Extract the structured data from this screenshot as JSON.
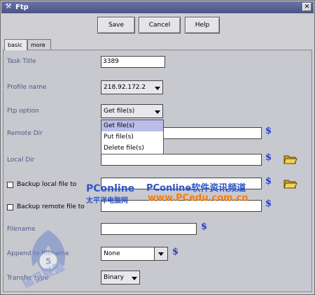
{
  "window": {
    "title": "Ftp",
    "close_glyph": "✕"
  },
  "toolbar": {
    "save": "Save",
    "cancel": "Cancel",
    "help": "Help"
  },
  "tabs": [
    {
      "label": "basic",
      "active": true
    },
    {
      "label": "more",
      "active": false
    }
  ],
  "form": {
    "task_title": {
      "label": "Task Title",
      "value": "3389"
    },
    "profile_name": {
      "label": "Profile name",
      "value": "218.92.172.2"
    },
    "ftp_option": {
      "label": "Ftp option",
      "value": "Get file(s)"
    },
    "remote_dir": {
      "label": "Remote Dir",
      "value": ""
    },
    "local_dir": {
      "label": "Local Dir",
      "value": ""
    },
    "backup_local": {
      "label": "Backup local file to",
      "checked": false,
      "value": ""
    },
    "backup_remote": {
      "label": "Backup remote file to",
      "checked": false,
      "value": ""
    },
    "filename": {
      "label": "Filename",
      "value": ""
    },
    "append_to_filename": {
      "label": "Append to filename",
      "value": "None"
    },
    "transfer_type": {
      "label": "Transfer type",
      "value": "Binary"
    }
  },
  "ftp_option_menu": [
    {
      "label": "Get file(s)",
      "selected": true
    },
    {
      "label": "Put file(s)",
      "selected": false
    },
    {
      "label": "Delete file(s)",
      "selected": false
    }
  ],
  "symbols": {
    "dollar": "$"
  },
  "watermarks": {
    "pconline_logo": "PConline",
    "pconline_logo_cn": "太平洋电脑网",
    "pconline_banner": "PConline软件资讯频道",
    "pconline_url": "www.PCedu.com.cn",
    "corner_logo": "猫目联盟"
  },
  "colors": {
    "label": "#4c5a84",
    "dollar": "#1f3cc8",
    "titlebar": "#4a5488",
    "watermark_blue": "#2f57c8",
    "watermark_orange": "#ff7a00"
  },
  "icons": [
    "app-icon",
    "close-icon",
    "folder-open-icon",
    "dollar-icon",
    "chevron-down-icon",
    "checkbox-icon"
  ]
}
